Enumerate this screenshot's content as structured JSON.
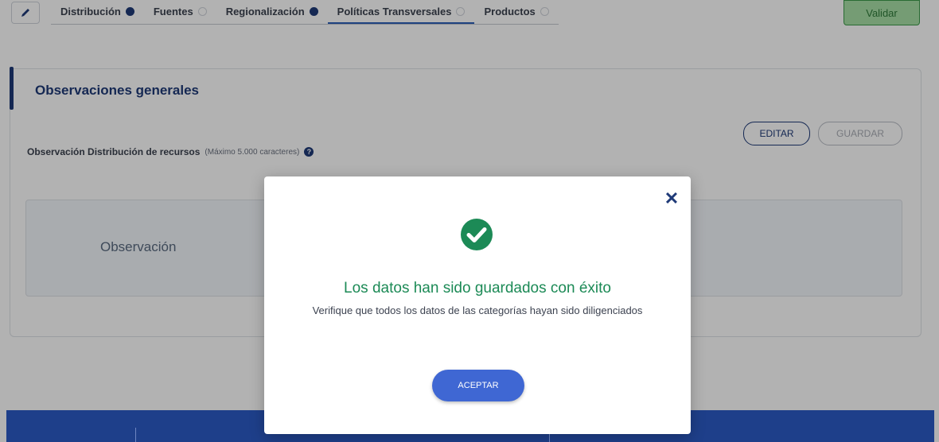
{
  "tabs": [
    {
      "label": "Distribución",
      "status": "complete"
    },
    {
      "label": "Fuentes",
      "status": "empty"
    },
    {
      "label": "Regionalización",
      "status": "complete"
    },
    {
      "label": "Políticas Transversales",
      "status": "empty"
    },
    {
      "label": "Productos",
      "status": "empty"
    }
  ],
  "toolbar": {
    "validate_label": "Validar"
  },
  "section": {
    "title": "Observaciones generales",
    "field_label": "Observación Distribución de recursos",
    "field_note": "(Máximo 5.000 caracteres)",
    "edit_label": "EDITAR",
    "save_label": "GUARDAR",
    "observation_placeholder": "Observación"
  },
  "modal": {
    "title": "Los datos han sido guardados con éxito",
    "message": "Verifique que todos los datos de las categorías hayan sido diligenciados",
    "accept_label": "ACEPTAR"
  },
  "colors": {
    "accent": "#1f3a78",
    "success": "#1c8a56",
    "primary_button": "#3f67d3",
    "footer": "#1e3f8a"
  }
}
